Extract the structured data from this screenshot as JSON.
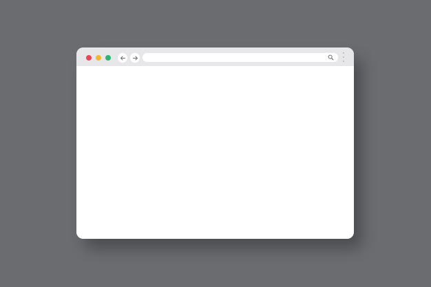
{
  "window": {
    "traffic_lights": {
      "close_color": "#e9465a",
      "minimize_color": "#f2b632",
      "zoom_color": "#2fb472"
    },
    "nav": {
      "back_icon": "arrow-left-icon",
      "forward_icon": "arrow-right-icon"
    },
    "address_bar": {
      "value": "",
      "placeholder": "",
      "search_icon": "search-icon"
    },
    "menu_icon": "kebab-menu-icon",
    "colors": {
      "desktop_background": "#6b6c70",
      "title_bar": "#e7e7e9",
      "content": "#ffffff",
      "icon_stroke": "#6d6d70"
    }
  }
}
